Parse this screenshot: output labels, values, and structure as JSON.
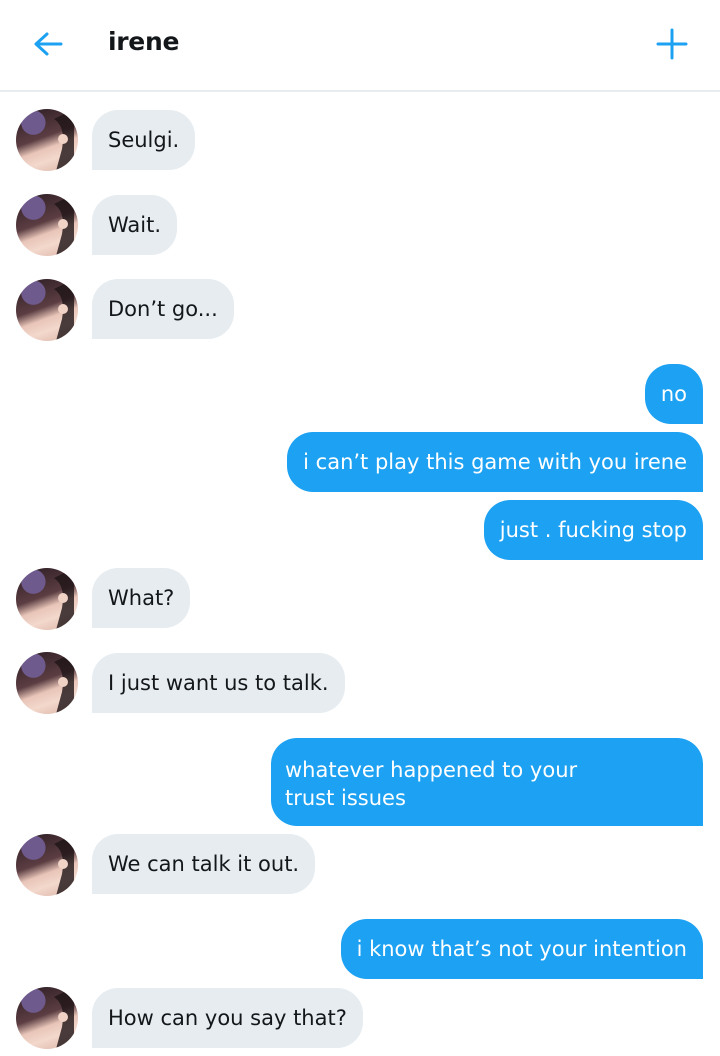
{
  "header": {
    "title": "irene",
    "back_icon": "arrow-left-icon",
    "new_icon": "plus-icon",
    "accent_color": "#1da1f2"
  },
  "messages": [
    {
      "side": "in",
      "text": "Seulgi."
    },
    {
      "side": "in",
      "text": "Wait."
    },
    {
      "side": "in",
      "text": "Don’t go..."
    },
    {
      "side": "out",
      "text": "no"
    },
    {
      "side": "out",
      "text": "i can’t play this game with you irene"
    },
    {
      "side": "out",
      "text": "just . fucking stop"
    },
    {
      "side": "in",
      "text": "What?"
    },
    {
      "side": "in",
      "text": "I just want us to talk."
    },
    {
      "side": "out",
      "lines": [
        "whatever happened to your",
        "trust issues"
      ]
    },
    {
      "side": "in",
      "text": "We can talk it out."
    },
    {
      "side": "out",
      "text": "i know that’s not your intention"
    },
    {
      "side": "in",
      "text": "How can you say that?"
    }
  ],
  "colors": {
    "incoming_bubble": "#e6ecf0",
    "outgoing_bubble": "#1da1f2"
  }
}
